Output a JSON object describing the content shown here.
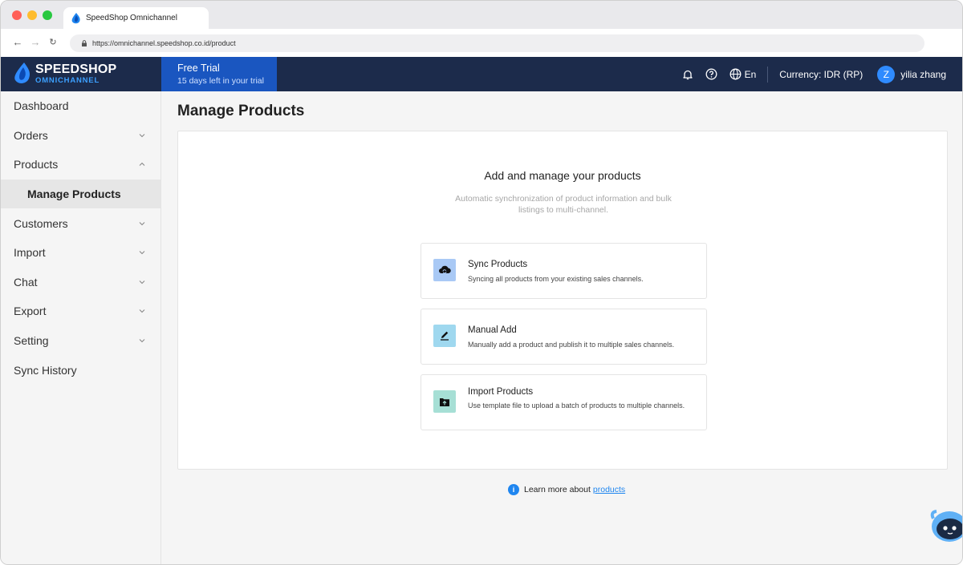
{
  "browser": {
    "tab_title": "SpeedShop Omnichannel",
    "url": "https://omnichannel.speedshop.co.id/product"
  },
  "header": {
    "logo_top": "SPEEDSHOP",
    "logo_bottom": "OMNICHANNEL",
    "trial_title": "Free Trial",
    "trial_sub": "15 days left in your trial",
    "language": "En",
    "currency": "Currency: IDR (RP)",
    "avatar_initial": "Z",
    "user_name": "yilia zhang"
  },
  "sidebar": {
    "items": [
      {
        "label": "Dashboard"
      },
      {
        "label": "Orders"
      },
      {
        "label": "Products"
      },
      {
        "label": "Manage Products"
      },
      {
        "label": "Customers"
      },
      {
        "label": "Import"
      },
      {
        "label": "Chat"
      },
      {
        "label": "Export"
      },
      {
        "label": "Setting"
      },
      {
        "label": "Sync History"
      }
    ]
  },
  "main": {
    "page_title": "Manage Products",
    "card_title": "Add and manage your products",
    "card_sub": "Automatic synchronization of product information and bulk listings to multi-channel.",
    "options": [
      {
        "title": "Sync Products",
        "desc": "Syncing all products from your existing sales channels."
      },
      {
        "title": "Manual Add",
        "desc": "Manually add a product and publish it to multiple sales channels."
      },
      {
        "title": "Import Products",
        "desc": "Use template file to upload a batch of products to multiple channels."
      }
    ],
    "learn_text": "Learn more about",
    "learn_link": "products"
  },
  "colors": {
    "header_bg": "#1c2b4b",
    "trial_bg": "#1a56c0",
    "accent": "#1f86f0"
  }
}
